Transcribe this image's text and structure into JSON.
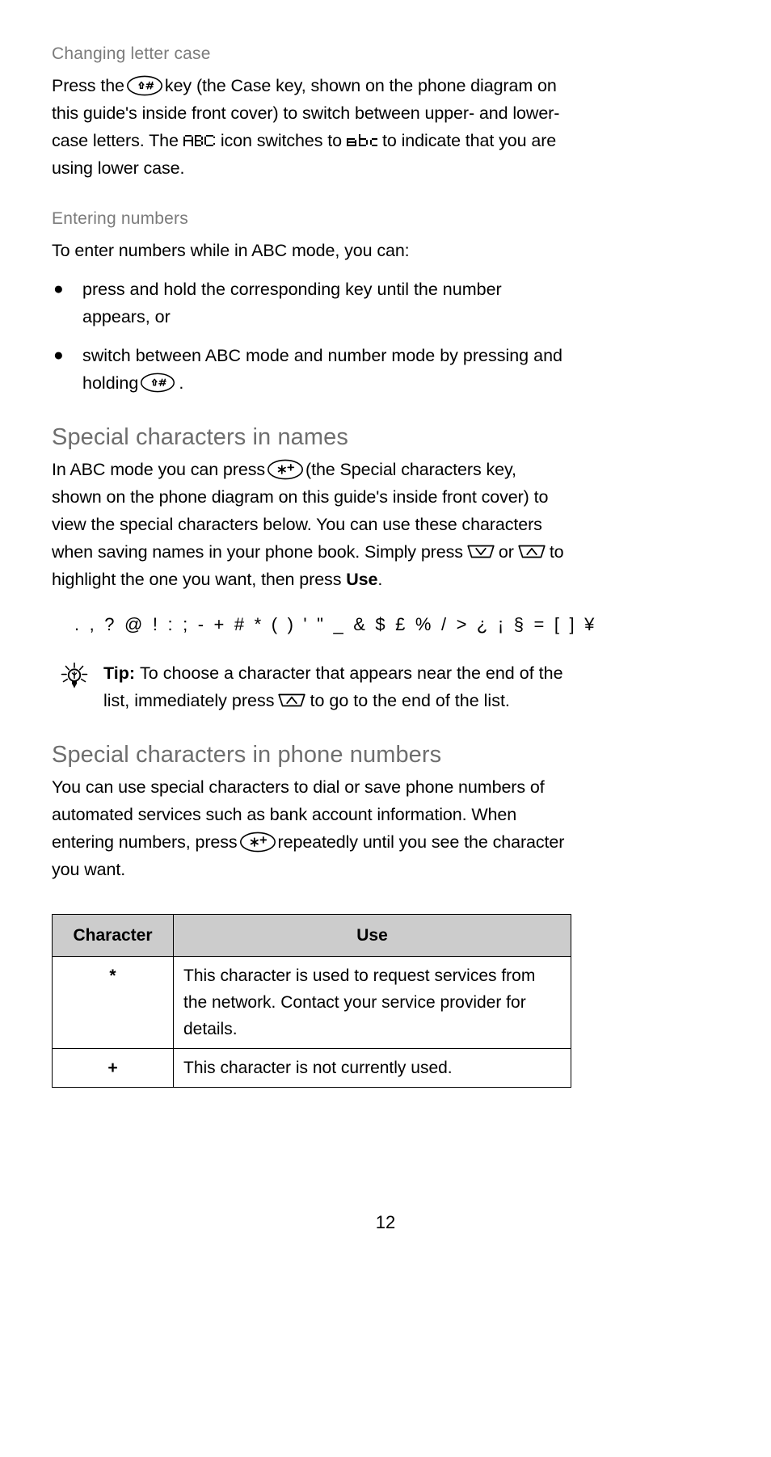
{
  "document": {
    "page_number": "12"
  },
  "sections": {
    "changing_letter_case": {
      "heading": "Changing letter case",
      "para_before_key": "Press the",
      "para_after_key": "key (the Case key, shown on the phone diagram on this guide's inside front cover) to switch between upper- and lower-case letters. The",
      "para_mid": "icon switches to",
      "para_end": "to indicate that you are using lower case.",
      "key_label": "case-key",
      "lcd_upper": "ABC",
      "lcd_lower": "abc"
    },
    "entering_numbers": {
      "heading": "Entering numbers",
      "intro": "To enter numbers while in ABC mode, you can:",
      "bullets": [
        {
          "text": "press and hold the corresponding key until the number appears, or"
        },
        {
          "text_before_key": "switch between ABC mode and number mode by pressing and holding",
          "text_after_key": "."
        }
      ]
    },
    "special_characters_in_names": {
      "heading": "Special characters in names",
      "para_1": "In ABC mode you can press",
      "para_2": "(the Special characters key, shown on the phone diagram on this guide's inside front cover) to view the special characters below. You can use these characters when saving names in your phone book. Simply press",
      "para_or": "or",
      "para_3": "to highlight the one you want, then press",
      "use_label": "Use",
      "period": ".",
      "special_characters": ". , ? @ ! : ; - + # * ( ) ' \" _ & $ £ % / > ¿ ¡ § = [ ] ¥",
      "tip": {
        "label": "Tip:",
        "text_before_key": "To choose a character that appears near the end of the list, immediately press",
        "text_after_key": "to go to the end of the list."
      }
    },
    "special_characters_in_phone_numbers": {
      "heading": "Special characters in phone numbers",
      "para_before_key": "You can use special characters to dial or save phone numbers of automated services such as bank account information. When entering numbers, press",
      "para_after_key": "repeatedly until you see the character you want."
    }
  },
  "table": {
    "headers": [
      "Character",
      "Use"
    ],
    "rows": [
      {
        "character": "*",
        "use": "This character is used to request services from the network. Contact your service provider for details."
      },
      {
        "character": "+",
        "use": "This character is not currently used."
      }
    ]
  },
  "colors": {
    "heading_gray": "#6e6e6e",
    "subheading_gray": "#7b7b7b",
    "table_header_bg": "#cccccc",
    "border": "#000000",
    "text": "#000000"
  },
  "icons": {
    "case_key": "case-key-icon",
    "star_key": "star-plus-key-icon",
    "nav_down": "nav-down-key-icon",
    "nav_up": "nav-up-key-icon",
    "tip_bulb": "lightbulb-icon",
    "lcd_abc_upper": "lcd-abc-uppercase-icon",
    "lcd_abc_lower": "lcd-abc-lowercase-icon"
  }
}
